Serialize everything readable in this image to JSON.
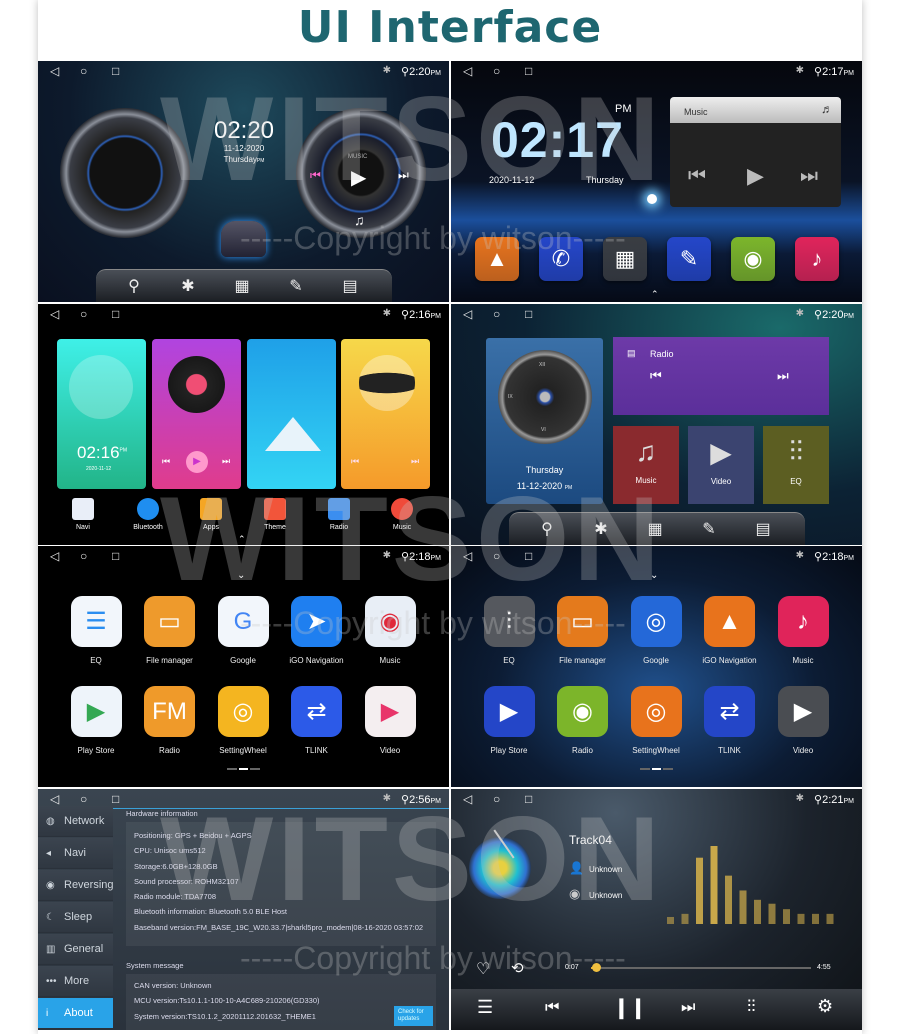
{
  "page_title": "UI Interface",
  "watermark": {
    "logo": "WITSON",
    "copyright": "-----Copyright by witson-----"
  },
  "status_nav": {
    "back": "◁",
    "home": "○",
    "recent": "□",
    "bluetooth": "✱",
    "location": "⚲"
  },
  "panel1": {
    "status_time": "2:20",
    "ampm": "PM",
    "clock": "02:20",
    "date": "11-12-2020",
    "day": "Thursday",
    "ampm_small": "PM",
    "music_label": "MUSIC",
    "dock_icons": [
      "location-pin-icon",
      "bluetooth-icon",
      "apps-grid-icon",
      "theme-brush-icon",
      "radio-icon"
    ]
  },
  "panel2": {
    "status_time": "2:17",
    "ampm": "PM",
    "clock": "02:17",
    "clock_ampm": "PM",
    "date": "2020-11-12",
    "day": "Thursday",
    "music_widget_title": "Music",
    "tiles": [
      {
        "icon": "navigation-icon",
        "color": "#e8731c"
      },
      {
        "icon": "bluetooth-phone-icon",
        "color": "#2546c8"
      },
      {
        "icon": "apps-icon",
        "color": "#3a3d42"
      },
      {
        "icon": "theme-brush-icon",
        "color": "#2446c8"
      },
      {
        "icon": "radio-icon",
        "color": "#7cb52a"
      },
      {
        "icon": "music-icon",
        "color": "#e0245a"
      }
    ]
  },
  "panel3": {
    "status_time": "2:16",
    "ampm": "PM",
    "clock": "02:16",
    "clock_ampm": "PM",
    "date": "2020-11-12",
    "dock": [
      {
        "label": "Navi",
        "icon": "navi-icon",
        "color": "#e9eef8"
      },
      {
        "label": "Bluetooth",
        "icon": "bluetooth-phone-icon",
        "color": "#1f8ef0"
      },
      {
        "label": "Apps",
        "icon": "apps-icon",
        "color": "#f5a623"
      },
      {
        "label": "Theme",
        "icon": "theme-icon",
        "color": "#f2553a"
      },
      {
        "label": "Radio",
        "icon": "radio-icon",
        "color": "#3b8ef0"
      },
      {
        "label": "Music",
        "icon": "music-icon",
        "color": "#f04a3a"
      }
    ]
  },
  "panel4": {
    "status_time": "2:20",
    "ampm": "PM",
    "day": "Thursday",
    "date": "11-12-2020",
    "date_ampm": "PM",
    "clock_numerals": [
      "XII",
      "IX",
      "VI"
    ],
    "radio_title": "Radio",
    "tiles": [
      {
        "label": "Music",
        "icon": "music-note-icon",
        "color": "#8a2a2e"
      },
      {
        "label": "Video",
        "icon": "video-icon",
        "color": "#3b4470"
      },
      {
        "label": "EQ",
        "icon": "equalizer-icon",
        "color": "#5c5e22"
      }
    ]
  },
  "panel5": {
    "status_time": "2:18",
    "ampm": "PM",
    "apps": [
      {
        "label": "EQ",
        "icon": "eq-icon",
        "bg": "#f2f6fb",
        "fg": "#2a8df0",
        "glyph": "☰"
      },
      {
        "label": "File manager",
        "icon": "folder-icon",
        "bg": "#ee9a2c",
        "fg": "#fff",
        "glyph": "▭"
      },
      {
        "label": "Google",
        "icon": "google-icon",
        "bg": "#f2f6fb",
        "fg": "#4285f4",
        "glyph": "G"
      },
      {
        "label": "iGO Navigation",
        "icon": "paper-plane-icon",
        "bg": "#1f7ff0",
        "fg": "#fff",
        "glyph": "➤"
      },
      {
        "label": "Music",
        "icon": "vinyl-icon",
        "bg": "#e8eef6",
        "fg": "#e0283a",
        "glyph": "◉"
      },
      {
        "label": "Play Store",
        "icon": "play-store-icon",
        "bg": "#eef4fa",
        "fg": "#34a853",
        "glyph": "▶"
      },
      {
        "label": "Radio",
        "icon": "fm-radio-icon",
        "bg": "#ef9a2a",
        "fg": "#fff",
        "glyph": "FM"
      },
      {
        "label": "SettingWheel",
        "icon": "steering-wheel-icon",
        "bg": "#f4b520",
        "fg": "#fff",
        "glyph": "◎"
      },
      {
        "label": "TLINK",
        "icon": "tlink-icon",
        "bg": "#2c5ae8",
        "fg": "#fff",
        "glyph": "⇄"
      },
      {
        "label": "Video",
        "icon": "video-play-icon",
        "bg": "#f4eef0",
        "fg": "#e8356a",
        "glyph": "▶"
      }
    ]
  },
  "panel6": {
    "status_time": "2:18",
    "ampm": "PM",
    "apps": [
      {
        "label": "EQ",
        "icon": "eq-icon",
        "bg": "#55585e",
        "fg": "#fff",
        "glyph": "⫶"
      },
      {
        "label": "File manager",
        "icon": "folder-icon",
        "bg": "#e47a1c",
        "fg": "#fff",
        "glyph": "▭"
      },
      {
        "label": "Google",
        "icon": "chrome-icon",
        "bg": "#2468d8",
        "fg": "#fff",
        "glyph": "◎"
      },
      {
        "label": "iGO Navigation",
        "icon": "navigation-icon",
        "bg": "#e8731c",
        "fg": "#fff",
        "glyph": "▲"
      },
      {
        "label": "Music",
        "icon": "music-icon",
        "bg": "#e0245a",
        "fg": "#fff",
        "glyph": "♪"
      },
      {
        "label": "Play Store",
        "icon": "play-store-icon",
        "bg": "#2446c8",
        "fg": "#fff",
        "glyph": "▶"
      },
      {
        "label": "Radio",
        "icon": "radio-icon",
        "bg": "#7cb52a",
        "fg": "#fff",
        "glyph": "◉"
      },
      {
        "label": "SettingWheel",
        "icon": "steering-wheel-icon",
        "bg": "#e8731c",
        "fg": "#fff",
        "glyph": "◎"
      },
      {
        "label": "TLINK",
        "icon": "tlink-icon",
        "bg": "#2446c8",
        "fg": "#fff",
        "glyph": "⇄"
      },
      {
        "label": "Video",
        "icon": "video-icon",
        "bg": "#4a4d52",
        "fg": "#fff",
        "glyph": "▶"
      }
    ]
  },
  "panel7": {
    "status_time": "2:56",
    "ampm": "PM",
    "menu": [
      {
        "label": "Network",
        "glyph": "◍"
      },
      {
        "label": "Navi",
        "glyph": "◂"
      },
      {
        "label": "Reversing",
        "glyph": "◉"
      },
      {
        "label": "Sleep",
        "glyph": "☾"
      },
      {
        "label": "General",
        "glyph": "▥"
      },
      {
        "label": "More",
        "glyph": "•••"
      },
      {
        "label": "About",
        "glyph": "i",
        "selected": true
      }
    ],
    "hardware_title": "Hardware information",
    "hardware": [
      "Positioning: GPS + Beidou + AGPS",
      "CPU:  Unisoc ums512",
      "Storage:6.0GB+128.0GB",
      "Sound processor:  ROHM32107",
      "Radio module:  TDA7708",
      "Bluetooth information: Bluetooth 5.0 BLE Host",
      "Baseband version:FM_BASE_19C_W20.33.7|sharkl5pro_modem|08-16-2020 03:57:02"
    ],
    "system_title": "System message",
    "system": [
      "CAN version: Unknown",
      "MCU version:Ts10.1.1-100-10-A4C689-210206(GD330)",
      "System version:TS10.1.2_20201112.201632_THEME1"
    ],
    "check_updates": "Check for updates",
    "accent": "#29a3e8"
  },
  "panel8": {
    "status_time": "2:21",
    "ampm": "PM",
    "track": "Track04",
    "artist": "Unknown",
    "album": "Unknown",
    "elapsed": "0:07",
    "duration": "4:55",
    "progress": 0.024,
    "spectrum_levels": [
      0.09,
      0.13,
      0.85,
      1.0,
      0.62,
      0.43,
      0.31,
      0.26,
      0.19,
      0.13,
      0.13,
      0.13
    ],
    "spectrum_color": "#c9a84a"
  }
}
